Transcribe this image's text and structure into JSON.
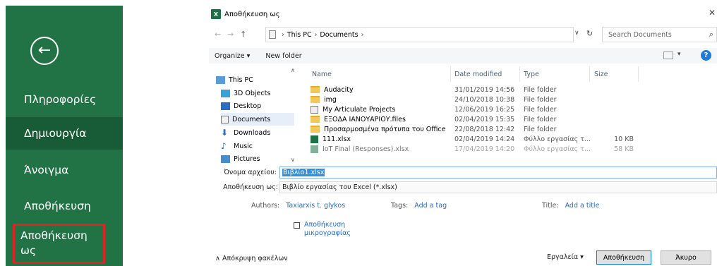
{
  "backstage": {
    "items": [
      "Πληροφορίες",
      "Δημιουργία",
      "Άνοιγμα",
      "Αποθήκευση"
    ],
    "save_as": "Αποθήκευση ως"
  },
  "dialog": {
    "title": "Αποθήκευση ως",
    "breadcrumb": [
      "This PC",
      "Documents"
    ],
    "search_placeholder": "Search Documents",
    "organize": "Organize ▾",
    "new_folder": "New folder",
    "nav_items": [
      "This PC",
      "3D Objects",
      "Desktop",
      "Documents",
      "Downloads",
      "Music",
      "Pictures"
    ],
    "columns": {
      "name": "Name",
      "date": "Date modified",
      "type": "Type",
      "size": "Size"
    },
    "files": [
      {
        "name": "Audacity",
        "date": "31/01/2019 14:56",
        "type": "File folder",
        "size": "",
        "icon": "folder"
      },
      {
        "name": "img",
        "date": "24/10/2018 10:38",
        "type": "File folder",
        "size": "",
        "icon": "folder"
      },
      {
        "name": "My Articulate Projects",
        "date": "12/06/2019 16:25",
        "type": "File folder",
        "size": "",
        "icon": "project"
      },
      {
        "name": "ΕΞΟΔΑ ΙΑΝΟΥΑΡΙΟΥ.files",
        "date": "02/04/2019 15:35",
        "type": "File folder",
        "size": "",
        "icon": "folder"
      },
      {
        "name": "Προσαρμοσμένα πρότυπα του Office",
        "date": "22/08/2018 12:42",
        "type": "File folder",
        "size": "",
        "icon": "folder"
      },
      {
        "name": "111.xlsx",
        "date": "02/04/2019 14:24",
        "type": "Φύλλο εργασίας τ...",
        "size": "10 KB",
        "icon": "excel"
      },
      {
        "name": "IoT Final (Responses).xlsx",
        "date": "17/04/2019 14:20",
        "type": "Φύλλο εργασίας τ...",
        "size": "58 KB",
        "icon": "excel"
      }
    ],
    "filename_label": "Όνομα αρχείου:",
    "filename": "Βιβλίο1.xlsx",
    "savetype_label": "Αποθήκευση ως:",
    "savetype": "Βιβλίο εργασίας του Excel (*.xlsx)",
    "authors_label": "Authors:",
    "authors": "Taxiarxis t. glykos",
    "tags_label": "Tags:",
    "tags": "Add a tag",
    "title_label": "Title:",
    "title_value": "Add a title",
    "thumbnail_line1": "Αποθήκευση",
    "thumbnail_line2": "μικρογραφίας",
    "hide_folders": "∧  Απόκρυψη φακέλων",
    "tools": "Εργαλεία  ▾",
    "save_button": "Αποθήκευση",
    "cancel_button": "Άκυρο"
  }
}
